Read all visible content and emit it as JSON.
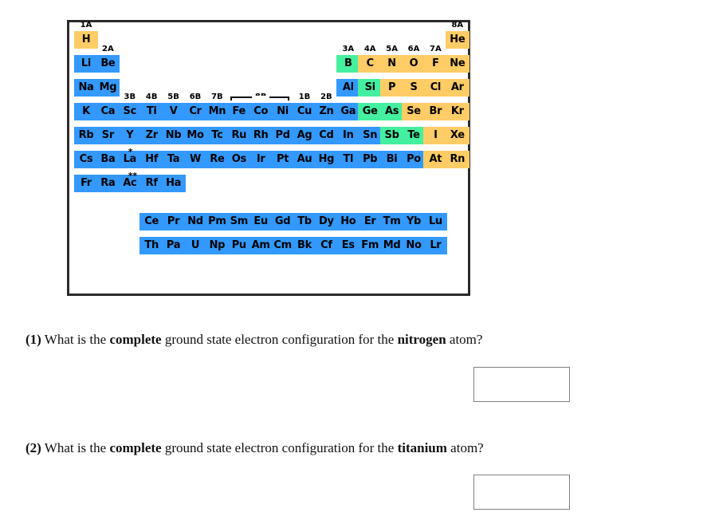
{
  "periodic_table": {
    "legend_colors": {
      "metal": "#3399ff",
      "nonmetal": "#ffcc66",
      "metalloid": "#44efa0",
      "border": "#2b2b2b"
    },
    "group_labels": [
      {
        "text": "1A",
        "col": 1,
        "row": 0
      },
      {
        "text": "2A",
        "col": 2,
        "row": 1
      },
      {
        "text": "3B",
        "col": 3,
        "row": 3
      },
      {
        "text": "4B",
        "col": 4,
        "row": 3
      },
      {
        "text": "5B",
        "col": 5,
        "row": 3
      },
      {
        "text": "6B",
        "col": 6,
        "row": 3
      },
      {
        "text": "7B",
        "col": 7,
        "row": 3
      },
      {
        "text": "8B",
        "col": 9,
        "row": 3
      },
      {
        "text": "1B",
        "col": 11,
        "row": 3
      },
      {
        "text": "2B",
        "col": 12,
        "row": 3
      },
      {
        "text": "3A",
        "col": 13,
        "row": 1
      },
      {
        "text": "4A",
        "col": 14,
        "row": 1
      },
      {
        "text": "5A",
        "col": 15,
        "row": 1
      },
      {
        "text": "6A",
        "col": 16,
        "row": 1
      },
      {
        "text": "7A",
        "col": 17,
        "row": 1
      },
      {
        "text": "8A",
        "col": 18,
        "row": 0
      }
    ],
    "elements": [
      {
        "sym": "H",
        "col": 1,
        "row": 1,
        "type": "nonmetal"
      },
      {
        "sym": "He",
        "col": 18,
        "row": 1,
        "type": "nonmetal"
      },
      {
        "sym": "Li",
        "col": 1,
        "row": 2,
        "type": "metal"
      },
      {
        "sym": "Be",
        "col": 2,
        "row": 2,
        "type": "metal"
      },
      {
        "sym": "B",
        "col": 13,
        "row": 2,
        "type": "metalloid"
      },
      {
        "sym": "C",
        "col": 14,
        "row": 2,
        "type": "nonmetal"
      },
      {
        "sym": "N",
        "col": 15,
        "row": 2,
        "type": "nonmetal"
      },
      {
        "sym": "O",
        "col": 16,
        "row": 2,
        "type": "nonmetal"
      },
      {
        "sym": "F",
        "col": 17,
        "row": 2,
        "type": "nonmetal"
      },
      {
        "sym": "Ne",
        "col": 18,
        "row": 2,
        "type": "nonmetal"
      },
      {
        "sym": "Na",
        "col": 1,
        "row": 3,
        "type": "metal"
      },
      {
        "sym": "Mg",
        "col": 2,
        "row": 3,
        "type": "metal"
      },
      {
        "sym": "Al",
        "col": 13,
        "row": 3,
        "type": "metal"
      },
      {
        "sym": "Si",
        "col": 14,
        "row": 3,
        "type": "metalloid"
      },
      {
        "sym": "P",
        "col": 15,
        "row": 3,
        "type": "nonmetal"
      },
      {
        "sym": "S",
        "col": 16,
        "row": 3,
        "type": "nonmetal"
      },
      {
        "sym": "Cl",
        "col": 17,
        "row": 3,
        "type": "nonmetal"
      },
      {
        "sym": "Ar",
        "col": 18,
        "row": 3,
        "type": "nonmetal"
      },
      {
        "sym": "K",
        "col": 1,
        "row": 4,
        "type": "metal"
      },
      {
        "sym": "Ca",
        "col": 2,
        "row": 4,
        "type": "metal"
      },
      {
        "sym": "Sc",
        "col": 3,
        "row": 4,
        "type": "metal"
      },
      {
        "sym": "Ti",
        "col": 4,
        "row": 4,
        "type": "metal"
      },
      {
        "sym": "V",
        "col": 5,
        "row": 4,
        "type": "metal"
      },
      {
        "sym": "Cr",
        "col": 6,
        "row": 4,
        "type": "metal"
      },
      {
        "sym": "Mn",
        "col": 7,
        "row": 4,
        "type": "metal"
      },
      {
        "sym": "Fe",
        "col": 8,
        "row": 4,
        "type": "metal"
      },
      {
        "sym": "Co",
        "col": 9,
        "row": 4,
        "type": "metal"
      },
      {
        "sym": "Ni",
        "col": 10,
        "row": 4,
        "type": "metal"
      },
      {
        "sym": "Cu",
        "col": 11,
        "row": 4,
        "type": "metal"
      },
      {
        "sym": "Zn",
        "col": 12,
        "row": 4,
        "type": "metal"
      },
      {
        "sym": "Ga",
        "col": 13,
        "row": 4,
        "type": "metal"
      },
      {
        "sym": "Ge",
        "col": 14,
        "row": 4,
        "type": "metalloid"
      },
      {
        "sym": "As",
        "col": 15,
        "row": 4,
        "type": "metalloid"
      },
      {
        "sym": "Se",
        "col": 16,
        "row": 4,
        "type": "nonmetal"
      },
      {
        "sym": "Br",
        "col": 17,
        "row": 4,
        "type": "nonmetal"
      },
      {
        "sym": "Kr",
        "col": 18,
        "row": 4,
        "type": "nonmetal"
      },
      {
        "sym": "Rb",
        "col": 1,
        "row": 5,
        "type": "metal"
      },
      {
        "sym": "Sr",
        "col": 2,
        "row": 5,
        "type": "metal"
      },
      {
        "sym": "Y",
        "col": 3,
        "row": 5,
        "type": "metal"
      },
      {
        "sym": "Zr",
        "col": 4,
        "row": 5,
        "type": "metal"
      },
      {
        "sym": "Nb",
        "col": 5,
        "row": 5,
        "type": "metal"
      },
      {
        "sym": "Mo",
        "col": 6,
        "row": 5,
        "type": "metal"
      },
      {
        "sym": "Tc",
        "col": 7,
        "row": 5,
        "type": "metal"
      },
      {
        "sym": "Ru",
        "col": 8,
        "row": 5,
        "type": "metal"
      },
      {
        "sym": "Rh",
        "col": 9,
        "row": 5,
        "type": "metal"
      },
      {
        "sym": "Pd",
        "col": 10,
        "row": 5,
        "type": "metal"
      },
      {
        "sym": "Ag",
        "col": 11,
        "row": 5,
        "type": "metal"
      },
      {
        "sym": "Cd",
        "col": 12,
        "row": 5,
        "type": "metal"
      },
      {
        "sym": "In",
        "col": 13,
        "row": 5,
        "type": "metal"
      },
      {
        "sym": "Sn",
        "col": 14,
        "row": 5,
        "type": "metal"
      },
      {
        "sym": "Sb",
        "col": 15,
        "row": 5,
        "type": "metalloid"
      },
      {
        "sym": "Te",
        "col": 16,
        "row": 5,
        "type": "metalloid"
      },
      {
        "sym": "I",
        "col": 17,
        "row": 5,
        "type": "nonmetal"
      },
      {
        "sym": "Xe",
        "col": 18,
        "row": 5,
        "type": "nonmetal"
      },
      {
        "sym": "Cs",
        "col": 1,
        "row": 6,
        "type": "metal"
      },
      {
        "sym": "Ba",
        "col": 2,
        "row": 6,
        "type": "metal"
      },
      {
        "sym": "La",
        "col": 3,
        "row": 6,
        "type": "metal",
        "sup": "*"
      },
      {
        "sym": "Hf",
        "col": 4,
        "row": 6,
        "type": "metal"
      },
      {
        "sym": "Ta",
        "col": 5,
        "row": 6,
        "type": "metal"
      },
      {
        "sym": "W",
        "col": 6,
        "row": 6,
        "type": "metal"
      },
      {
        "sym": "Re",
        "col": 7,
        "row": 6,
        "type": "metal"
      },
      {
        "sym": "Os",
        "col": 8,
        "row": 6,
        "type": "metal"
      },
      {
        "sym": "Ir",
        "col": 9,
        "row": 6,
        "type": "metal"
      },
      {
        "sym": "Pt",
        "col": 10,
        "row": 6,
        "type": "metal"
      },
      {
        "sym": "Au",
        "col": 11,
        "row": 6,
        "type": "metal"
      },
      {
        "sym": "Hg",
        "col": 12,
        "row": 6,
        "type": "metal"
      },
      {
        "sym": "Tl",
        "col": 13,
        "row": 6,
        "type": "metal"
      },
      {
        "sym": "Pb",
        "col": 14,
        "row": 6,
        "type": "metal"
      },
      {
        "sym": "Bi",
        "col": 15,
        "row": 6,
        "type": "metal"
      },
      {
        "sym": "Po",
        "col": 16,
        "row": 6,
        "type": "metal"
      },
      {
        "sym": "At",
        "col": 17,
        "row": 6,
        "type": "nonmetal"
      },
      {
        "sym": "Rn",
        "col": 18,
        "row": 6,
        "type": "nonmetal"
      },
      {
        "sym": "Fr",
        "col": 1,
        "row": 7,
        "type": "metal"
      },
      {
        "sym": "Ra",
        "col": 2,
        "row": 7,
        "type": "metal"
      },
      {
        "sym": "Ac",
        "col": 3,
        "row": 7,
        "type": "metal",
        "sup": "**"
      },
      {
        "sym": "Rf",
        "col": 4,
        "row": 7,
        "type": "metal"
      },
      {
        "sym": "Ha",
        "col": 5,
        "row": 7,
        "type": "metal"
      },
      {
        "sym": "Ce",
        "col": 4,
        "row": 8.6,
        "type": "metal"
      },
      {
        "sym": "Pr",
        "col": 5,
        "row": 8.6,
        "type": "metal"
      },
      {
        "sym": "Nd",
        "col": 6,
        "row": 8.6,
        "type": "metal"
      },
      {
        "sym": "Pm",
        "col": 7,
        "row": 8.6,
        "type": "metal"
      },
      {
        "sym": "Sm",
        "col": 8,
        "row": 8.6,
        "type": "metal"
      },
      {
        "sym": "Eu",
        "col": 9,
        "row": 8.6,
        "type": "metal"
      },
      {
        "sym": "Gd",
        "col": 10,
        "row": 8.6,
        "type": "metal"
      },
      {
        "sym": "Tb",
        "col": 11,
        "row": 8.6,
        "type": "metal"
      },
      {
        "sym": "Dy",
        "col": 12,
        "row": 8.6,
        "type": "metal"
      },
      {
        "sym": "Ho",
        "col": 13,
        "row": 8.6,
        "type": "metal"
      },
      {
        "sym": "Er",
        "col": 14,
        "row": 8.6,
        "type": "metal"
      },
      {
        "sym": "Tm",
        "col": 15,
        "row": 8.6,
        "type": "metal"
      },
      {
        "sym": "Yb",
        "col": 16,
        "row": 8.6,
        "type": "metal"
      },
      {
        "sym": "Lu",
        "col": 17,
        "row": 8.6,
        "type": "metal"
      },
      {
        "sym": "Th",
        "col": 4,
        "row": 9.6,
        "type": "metal"
      },
      {
        "sym": "Pa",
        "col": 5,
        "row": 9.6,
        "type": "metal"
      },
      {
        "sym": "U",
        "col": 6,
        "row": 9.6,
        "type": "metal"
      },
      {
        "sym": "Np",
        "col": 7,
        "row": 9.6,
        "type": "metal"
      },
      {
        "sym": "Pu",
        "col": 8,
        "row": 9.6,
        "type": "metal"
      },
      {
        "sym": "Am",
        "col": 9,
        "row": 9.6,
        "type": "metal"
      },
      {
        "sym": "Cm",
        "col": 10,
        "row": 9.6,
        "type": "metal"
      },
      {
        "sym": "Bk",
        "col": 11,
        "row": 9.6,
        "type": "metal"
      },
      {
        "sym": "Cf",
        "col": 12,
        "row": 9.6,
        "type": "metal"
      },
      {
        "sym": "Es",
        "col": 13,
        "row": 9.6,
        "type": "metal"
      },
      {
        "sym": "Fm",
        "col": 14,
        "row": 9.6,
        "type": "metal"
      },
      {
        "sym": "Md",
        "col": 15,
        "row": 9.6,
        "type": "metal"
      },
      {
        "sym": "No",
        "col": 16,
        "row": 9.6,
        "type": "metal"
      },
      {
        "sym": "Lr",
        "col": 17,
        "row": 9.6,
        "type": "metal"
      }
    ]
  },
  "questions": [
    {
      "number": "(1)",
      "part1": " What is the ",
      "emphasis1": "complete",
      "part2": " ground state electron configuration for the ",
      "emphasis2": "nitrogen",
      "part3": " atom?",
      "answer_value": "",
      "answer_placeholder": ""
    },
    {
      "number": "(2)",
      "part1": " What is the ",
      "emphasis1": "complete",
      "part2": " ground state electron configuration for the ",
      "emphasis2": "titanium",
      "part3": " atom?",
      "answer_value": "",
      "answer_placeholder": ""
    }
  ]
}
